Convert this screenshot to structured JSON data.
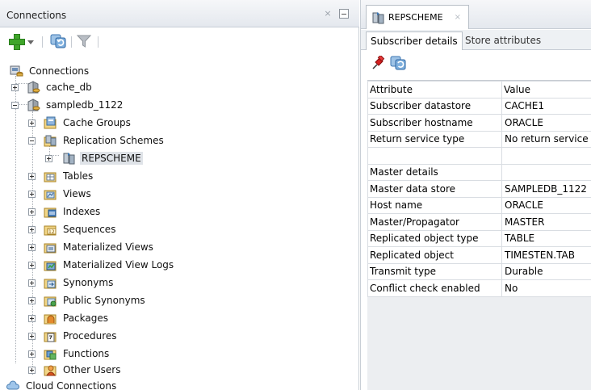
{
  "left_panel": {
    "title": "Connections",
    "close_glyph": "×",
    "toolbar": {
      "icons": [
        "add-icon",
        "dropdown-arrow-icon",
        "refresh-icon",
        "filter-icon"
      ]
    },
    "tree": {
      "root": "Connections",
      "connections": [
        {
          "label": "cache_db",
          "expanded": false
        },
        {
          "label": "sampledb_1122",
          "expanded": true
        }
      ],
      "sampledb_children": [
        {
          "label": "Cache Groups",
          "icon": "cache-groups-icon"
        },
        {
          "label": "Replication Schemes",
          "icon": "replication-schemes-icon",
          "expanded": true
        },
        {
          "label": "Tables",
          "icon": "tables-icon"
        },
        {
          "label": "Views",
          "icon": "views-icon"
        },
        {
          "label": "Indexes",
          "icon": "indexes-icon"
        },
        {
          "label": "Sequences",
          "icon": "sequences-icon"
        },
        {
          "label": "Materialized Views",
          "icon": "materialized-views-icon"
        },
        {
          "label": "Materialized View Logs",
          "icon": "materialized-view-logs-icon"
        },
        {
          "label": "Synonyms",
          "icon": "synonyms-icon"
        },
        {
          "label": "Public Synonyms",
          "icon": "public-synonyms-icon"
        },
        {
          "label": "Packages",
          "icon": "packages-icon"
        },
        {
          "label": "Procedures",
          "icon": "procedures-icon"
        },
        {
          "label": "Functions",
          "icon": "functions-icon"
        },
        {
          "label": "Other Users",
          "icon": "other-users-icon"
        }
      ],
      "replication_scheme": "REPSCHEME",
      "cloud": "Cloud Connections"
    }
  },
  "right_panel": {
    "tab": {
      "label": "REPSCHEME",
      "close_glyph": "×"
    },
    "subtabs": [
      "Subscriber details",
      "Store attributes"
    ],
    "active_subtab": "Subscriber details",
    "grid": {
      "headers": [
        "Attribute",
        "Value"
      ],
      "rows": [
        [
          "Subscriber datastore",
          "CACHE1"
        ],
        [
          "Subscriber hostname",
          "ORACLE"
        ],
        [
          "Return service type",
          "No return service"
        ],
        [
          "",
          ""
        ],
        [
          "Master details",
          ""
        ],
        [
          "Master data store",
          "SAMPLEDB_1122"
        ],
        [
          "Host name",
          "ORACLE"
        ],
        [
          "Master/Propagator",
          "MASTER"
        ],
        [
          "Replicated object type",
          "TABLE"
        ],
        [
          "Replicated object",
          "TIMESTEN.TAB"
        ],
        [
          "Transmit type",
          "Durable"
        ],
        [
          "Conflict check enabled",
          "No"
        ]
      ]
    }
  },
  "colors": {
    "header_bg": "#e8ebef",
    "selected_row": "#dfe3e8",
    "add_green": "#3fa52a"
  }
}
